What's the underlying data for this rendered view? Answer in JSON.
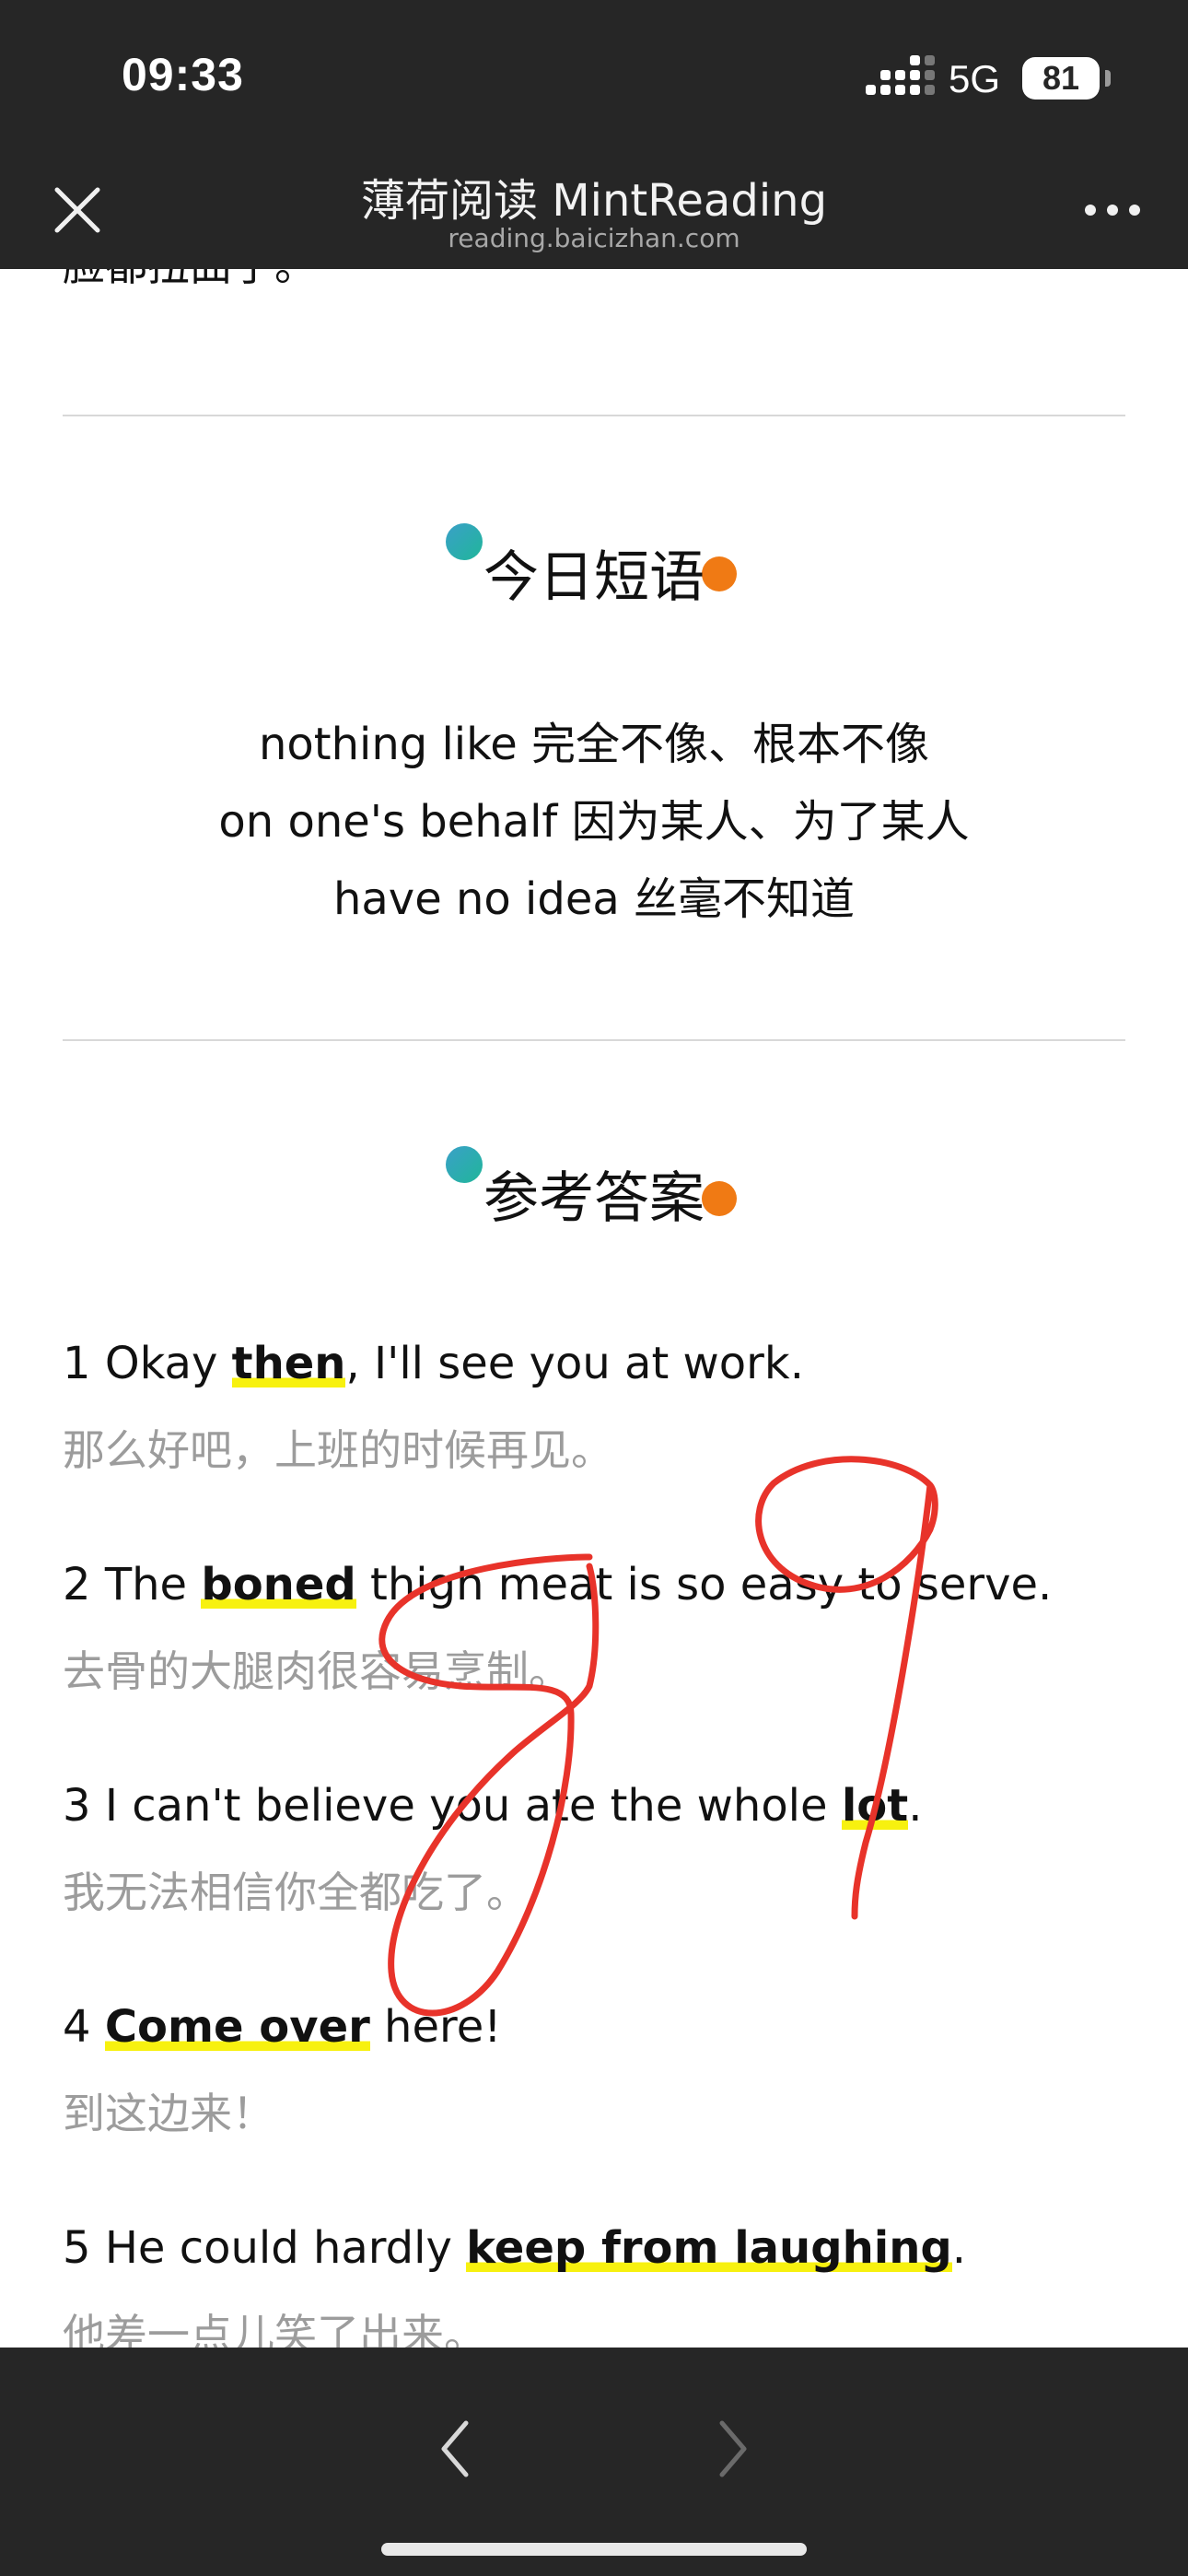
{
  "status_bar": {
    "time": "09:33",
    "network": "5G",
    "battery": "81"
  },
  "header": {
    "title": "薄荷阅读 MintReading",
    "subtitle": "reading.baicizhan.com"
  },
  "previous_text_tail": "脸都扭曲了。",
  "phrases_section": {
    "title": "今日短语",
    "items": [
      "nothing like 完全不像、根本不像",
      "on one's behalf 因为某人、为了某人",
      "have no idea 丝毫不知道"
    ]
  },
  "answers_section": {
    "title": "参考答案",
    "items": [
      {
        "num": "1",
        "before": "Okay ",
        "highlight": "then",
        "after": ", I'll see you at work.",
        "translation": "那么好吧，上班的时候再见。"
      },
      {
        "num": "2",
        "before": "The ",
        "highlight": "boned",
        "after": " thigh meat is so easy to serve.",
        "translation": "去骨的大腿肉很容易烹制。"
      },
      {
        "num": "3",
        "before": "I can't believe you ate the whole ",
        "highlight": "lot",
        "after": ".",
        "translation": "我无法相信你全都吃了。"
      },
      {
        "num": "4",
        "before": "",
        "highlight": "Come over",
        "after": " here!",
        "translation": "到这边来！"
      },
      {
        "num": "5",
        "before": "He could hardly ",
        "highlight": "keep from laughing",
        "after": ".",
        "translation": "他差一点儿笑了出来。"
      }
    ]
  },
  "handwritten_annotation": "89",
  "colors": {
    "bar_background": "#262626",
    "highlight": "#f7f10f",
    "annotation": "#e8332a",
    "dot_teal": "#20b69a",
    "dot_orange": "#f07a14"
  }
}
